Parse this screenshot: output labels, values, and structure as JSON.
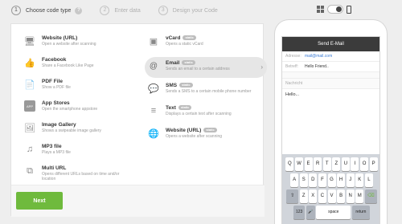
{
  "steps": [
    {
      "num": "1",
      "label": "Choose code type"
    },
    {
      "num": "2",
      "label": "Enter data"
    },
    {
      "num": "3",
      "label": "Design your Code"
    }
  ],
  "help_label": "?",
  "code_types_left": [
    {
      "title": "Website (URL)",
      "badge": "",
      "desc": "Open a website after scanning",
      "icon": "monitor-icon"
    },
    {
      "title": "Facebook",
      "badge": "",
      "desc": "Share a Facebook Like Page",
      "icon": "thumbs-up-icon"
    },
    {
      "title": "PDF File",
      "badge": "",
      "desc": "Show a PDF file",
      "icon": "pdf-icon"
    },
    {
      "title": "App Stores",
      "badge": "",
      "desc": "Open the smartphone appstore",
      "icon": "app-icon"
    },
    {
      "title": "Image Gallery",
      "badge": "",
      "desc": "Shows a swipeable image gallery",
      "icon": "image-icon"
    },
    {
      "title": "MP3 file",
      "badge": "",
      "desc": "Plays a MP3 file",
      "icon": "music-icon"
    },
    {
      "title": "Multi URL",
      "badge": "",
      "desc": "Opens different URLs based on time and/or location",
      "icon": "multi-url-icon"
    }
  ],
  "code_types_right": [
    {
      "title": "vCard",
      "badge": "static",
      "desc": "Opens a static vCard",
      "icon": "vcard-icon"
    },
    {
      "title": "Email",
      "badge": "static",
      "desc": "Sends an email to a certain address",
      "icon": "at-icon"
    },
    {
      "title": "SMS",
      "badge": "static",
      "desc": "Sends a SMS to a certain mobile phone number",
      "icon": "sms-icon"
    },
    {
      "title": "Text",
      "badge": "static",
      "desc": "Displays a certain text after scanning",
      "icon": "text-icon"
    },
    {
      "title": "Website (URL)",
      "badge": "static",
      "desc": "Opens a website after scanning",
      "icon": "globe-icon"
    }
  ],
  "icon_glyphs": {
    "monitor-icon": "🖥",
    "thumbs-up-icon": "👍",
    "pdf-icon": "📄",
    "app-icon": "APP",
    "image-icon": "🖼",
    "music-icon": "♫",
    "multi-url-icon": "⧉",
    "vcard-icon": "▣",
    "at-icon": "@",
    "sms-icon": "💬",
    "text-icon": "≡",
    "globe-icon": "🌐"
  },
  "next_label": "Next",
  "preview": {
    "header": "Send E-Mail",
    "to_label": "Adresse:",
    "to_value": "mail@mail.com",
    "subject_label": "Betreff:",
    "subject_value": "Hello Friend..",
    "message_label": "Nachricht",
    "message_value": "Hello..."
  },
  "keyboard": {
    "row1": [
      "Q",
      "W",
      "E",
      "R",
      "T",
      "Z",
      "U",
      "I",
      "O",
      "P"
    ],
    "row2": [
      "A",
      "S",
      "D",
      "F",
      "G",
      "H",
      "J",
      "K",
      "L"
    ],
    "row3": [
      "Z",
      "X",
      "C",
      "V",
      "B",
      "N",
      "M"
    ],
    "shift": "⇧",
    "backspace": "⌫",
    "num": "123",
    "mic": "🎤",
    "space": "space",
    "return": "return"
  },
  "colors": {
    "accent": "#6fba3d",
    "header": "#3b3b3b",
    "selected": "#e6e6e6"
  }
}
